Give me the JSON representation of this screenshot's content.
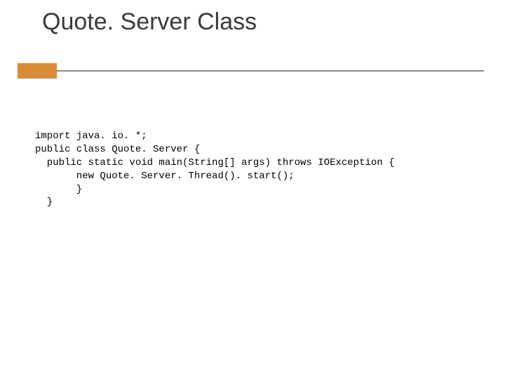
{
  "title": "Quote. Server Class",
  "code": {
    "line1": "import java. io. *;",
    "line2": "public class Quote. Server {",
    "line3": "  public static void main(String[] args) throws IOException {",
    "line4": "       new Quote. Server. Thread(). start();",
    "line5": "       }",
    "line6": "  }"
  }
}
